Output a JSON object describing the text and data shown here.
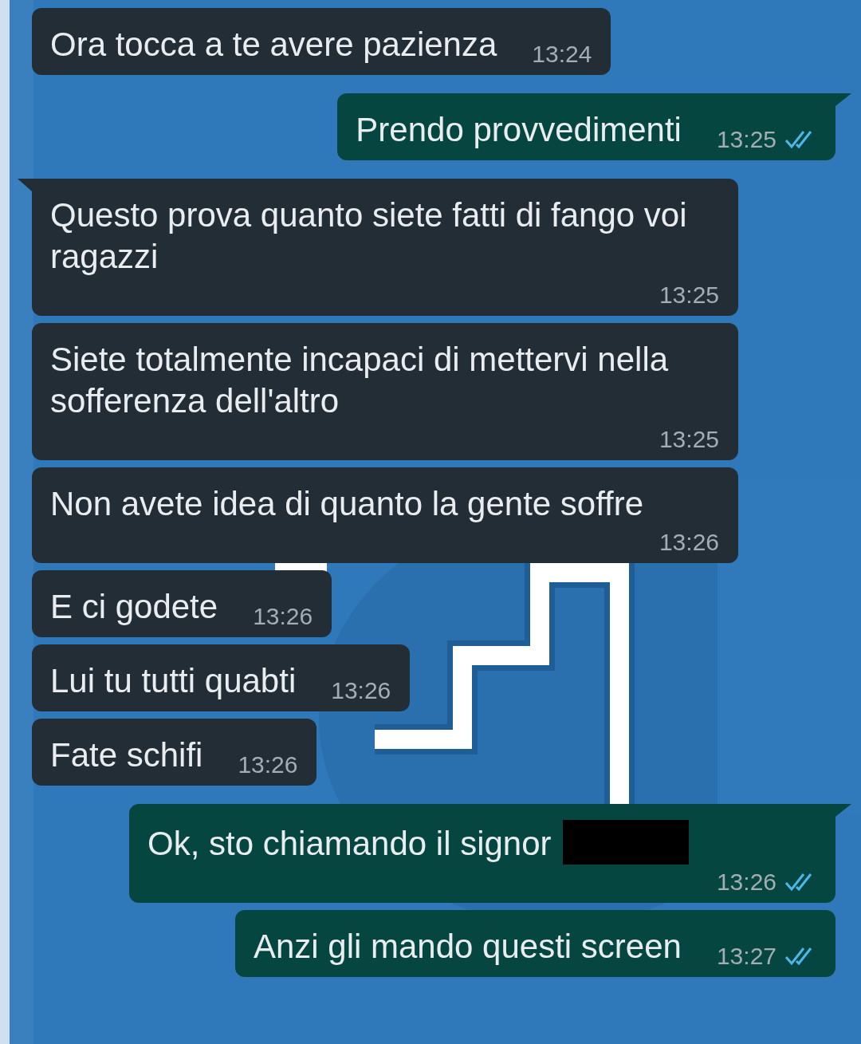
{
  "messages": [
    {
      "kind": "incoming",
      "tail": false,
      "text": "Ora tocca a te avere pazienza",
      "time": "13:24"
    },
    {
      "kind": "outgoing",
      "tail": true,
      "text": "Prendo provvedimenti",
      "time": "13:25",
      "read": true
    },
    {
      "kind": "incoming",
      "tail": true,
      "text": "Questo prova quanto siete fatti di fango voi ragazzi",
      "time": "13:25"
    },
    {
      "kind": "incoming",
      "tail": false,
      "text": "Siete totalmente incapaci di mettervi nella sofferenza dell'altro",
      "time": "13:25"
    },
    {
      "kind": "incoming",
      "tail": false,
      "text": "Non avete idea di quanto la gente soffre",
      "time": "13:26"
    },
    {
      "kind": "incoming",
      "tail": false,
      "text": "E ci godete",
      "time": "13:26"
    },
    {
      "kind": "incoming",
      "tail": false,
      "text": "Lui tu tutti quabti",
      "time": "13:26"
    },
    {
      "kind": "incoming",
      "tail": false,
      "text": "Fate schifi",
      "time": "13:26"
    },
    {
      "kind": "outgoing",
      "tail": true,
      "text": "Ok, sto chiamando il signor",
      "redacted": true,
      "time": "13:26",
      "read": true
    },
    {
      "kind": "outgoing",
      "tail": false,
      "text": "Anzi gli mando questi screen",
      "time": "13:27",
      "read": true
    }
  ]
}
